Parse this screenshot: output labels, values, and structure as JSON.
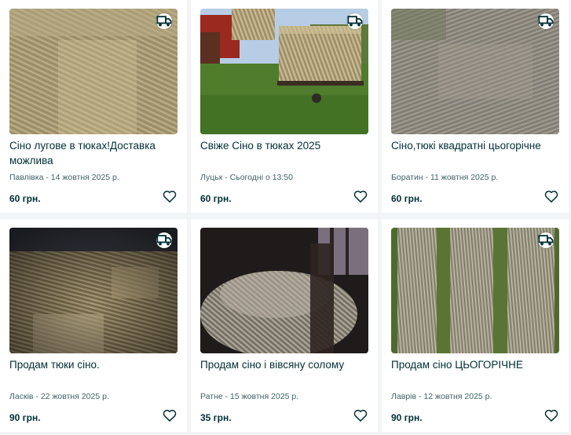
{
  "listings": [
    {
      "title": "Сіно лугове в тюках!Доставка можлива",
      "meta": "Павлівка - 14 жовтня 2025 р.",
      "price": "60 грн.",
      "delivery": true
    },
    {
      "title": "Свіже Сіно в тюках 2025",
      "meta": "Луцьк - Сьогодні о 13:50",
      "price": "60 грн.",
      "delivery": true
    },
    {
      "title": "Сіно,тюкі квадратні цьогорічне",
      "meta": "Боратин - 11 жовтня 2025 р.",
      "price": "60 грн.",
      "delivery": true
    },
    {
      "title": "Продам тюки сіно.",
      "meta": "Ласків - 22 жовтня 2025 р.",
      "price": "90 грн.",
      "delivery": true
    },
    {
      "title": "Продам сіно і вівсяну солому",
      "meta": "Ратне - 15 жовтня 2025 р.",
      "price": "35 грн.",
      "delivery": false
    },
    {
      "title": "Продам сіно ЦЬОГОРІЧНЕ",
      "meta": "Лаврів - 12 жовтня 2025 р.",
      "price": "90 грн.",
      "delivery": true
    }
  ],
  "icons": {
    "delivery": "delivery-truck-icon",
    "favorite": "heart-outline-icon"
  },
  "colors": {
    "page_background": "#f2f4f5",
    "card_background": "#ffffff",
    "text_primary": "#002f34",
    "text_secondary": "#406367"
  }
}
